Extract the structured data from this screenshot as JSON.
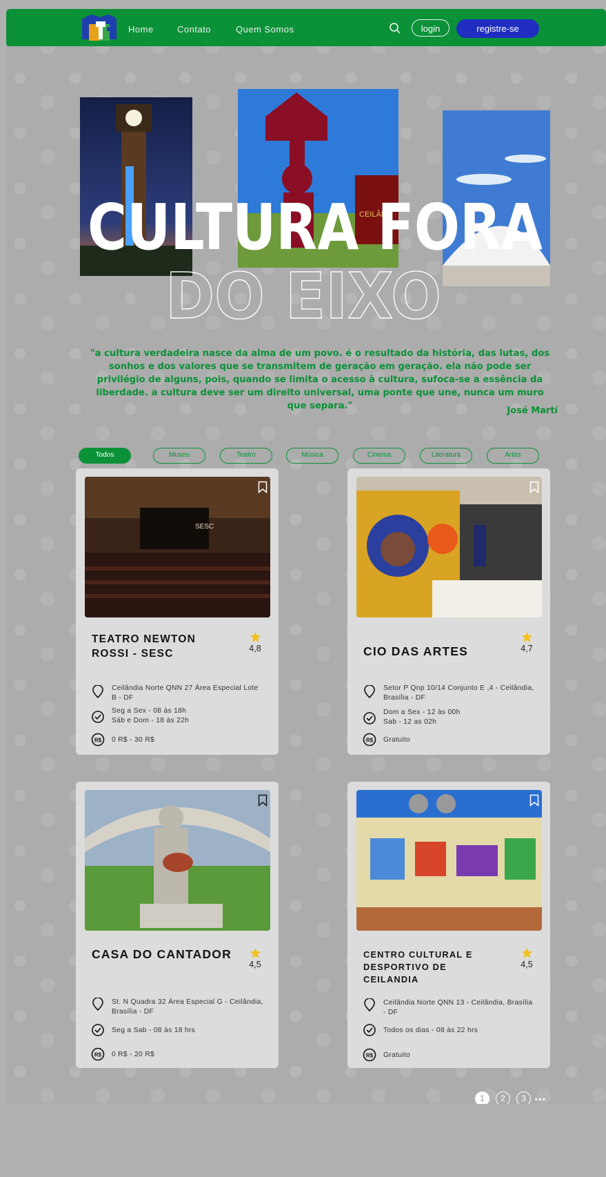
{
  "nav": {
    "links": [
      "Home",
      "Contato",
      "Quem Somos"
    ],
    "login": "login",
    "register": "registre-se"
  },
  "hero": {
    "line1": "CULTURA FORA",
    "line2": "DO EIXO"
  },
  "quote": {
    "text": "\"a cultura verdadeira nasce da alma de um povo. é o resultado da história, das lutas, dos sonhos e dos valores que se transmitem de geração em geração. ela não pode ser privilégio de alguns, pois, quando se limita o acesso à cultura, sufoca-se a essência da liberdade. a cultura deve ser um direito universal, uma ponte que une, nunca um muro que separa.\"",
    "author": "José Martí"
  },
  "filters": [
    "Todos",
    "Museu",
    "Teatro",
    "Música",
    "Cinema",
    "Literatura",
    "Artes"
  ],
  "active_filter": "Todos",
  "cards": [
    {
      "title": "TEATRO NEWTON ROSSI - SESC",
      "rating": "4,8",
      "address": "Ceilândia Norte QNN 27 Área Especial Lote B - DF",
      "hours": [
        "Seg a Sex - 08 às 18h",
        "Sáb e Dom - 18 às 22h"
      ],
      "price": "0 R$ - 30 R$"
    },
    {
      "title": "CIO DAS ARTES",
      "rating": "4,7",
      "address": "Setor P Qnp 10/14 Conjunto E ,4 - Ceilândia, Brasília - DF",
      "hours": [
        "Dom a Sex - 12 às 00h",
        "Sab - 12 as 02h"
      ],
      "price": "Gratuito"
    },
    {
      "title": "CASA DO CANTADOR",
      "rating": "4,5",
      "address": "St. N Quadra 32 Área Especial G - Ceilândia, Brasília - DF",
      "hours": [
        "Seg a Sab - 08 às 18 hrs"
      ],
      "price": "0 R$ - 20 R$"
    },
    {
      "title": "CENTRO CULTURAL E DESPORTIVO DE CEILANDIA",
      "rating": "4,5",
      "address": "Ceilândia Norte QNN 13 - Ceilândia, Brasília - DF",
      "hours": [
        "Todos os dias - 08 às 22 hrs"
      ],
      "price": "Gratuito"
    }
  ],
  "pagination": {
    "pages": [
      "1",
      "2",
      "3"
    ],
    "active": "1",
    "more": "..."
  },
  "colors": {
    "brand_green": "#0b9138",
    "register_blue": "#1f2ec0",
    "star_yellow": "#f3c11a"
  },
  "icons": {
    "search": "search-icon",
    "bookmark": "bookmark-icon",
    "location": "location-pin-icon",
    "clock": "clock-icon",
    "price": "price-icon",
    "star": "star-icon"
  }
}
